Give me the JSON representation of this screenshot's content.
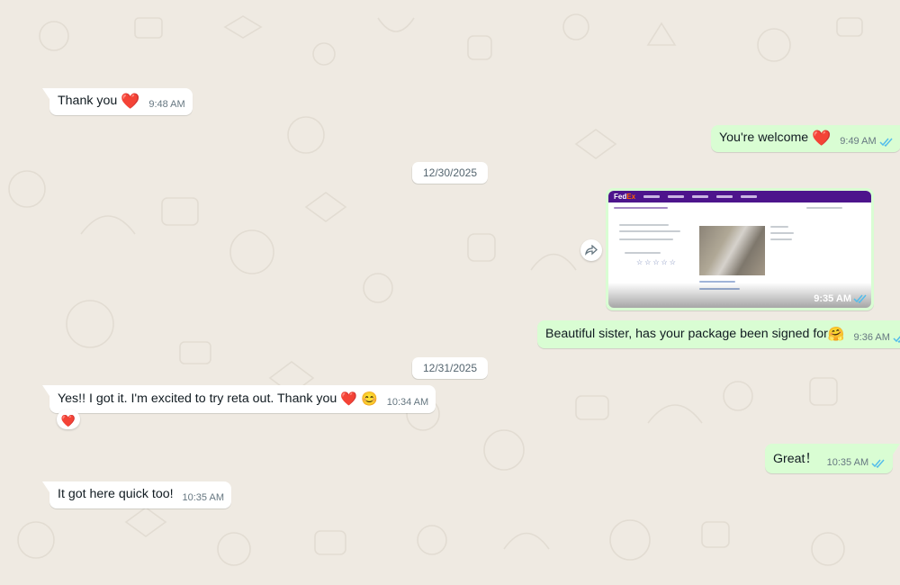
{
  "colors": {
    "background": "#efeae2",
    "incoming": "#ffffff",
    "outgoing": "#d9fdd3",
    "read_ticks": "#53bdeb",
    "heart": "#e3141b"
  },
  "messages": [
    {
      "text": "Thank you",
      "emoji": "❤️",
      "time": "9:48 AM",
      "direction": "incoming"
    },
    {
      "text": "You're welcome",
      "emoji": "❤️",
      "time": "9:49 AM",
      "direction": "outgoing",
      "status": "read"
    },
    {
      "image_time": "9:35 AM",
      "direction": "outgoing",
      "status": "read",
      "image_icon": "fedex-tracking-screenshot"
    },
    {
      "text": "Beautiful sister, has your package been signed for",
      "emoji": "🤗",
      "time": "9:36 AM",
      "direction": "outgoing",
      "status": "read"
    },
    {
      "text": "Yes!!  I got it.  I'm excited to try reta out.  Thank you",
      "emoji": "❤️ 😊",
      "time": "10:34 AM",
      "direction": "incoming",
      "reaction": "❤️"
    },
    {
      "text": "Great！",
      "time": "10:35 AM",
      "direction": "outgoing",
      "status": "read"
    },
    {
      "text": "It got here quick too!",
      "time": "10:35 AM",
      "direction": "incoming"
    }
  ],
  "dates": [
    "12/30/2025",
    "12/31/2025"
  ],
  "forward_icon": "forward-arrow-icon",
  "fedex_logo": {
    "part1": "Fed",
    "part2": "Ex"
  }
}
